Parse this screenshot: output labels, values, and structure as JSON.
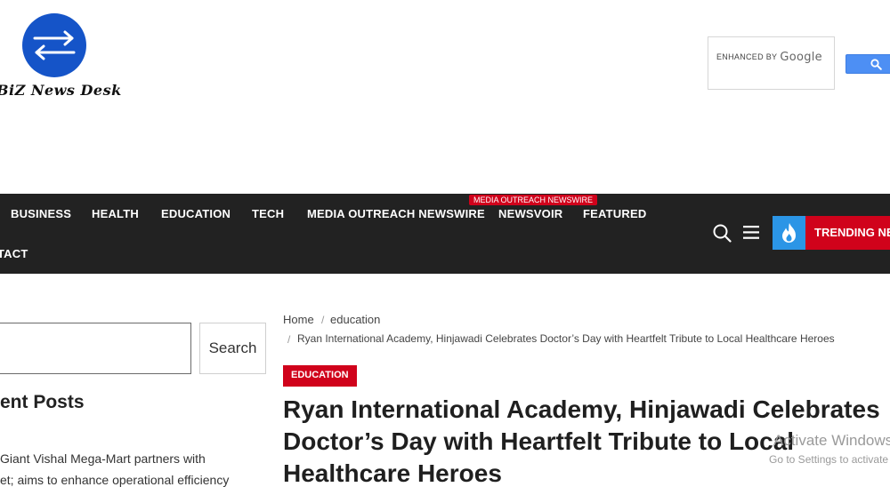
{
  "site": {
    "logo_text": "BiZ News Desk"
  },
  "search_widget": {
    "enhanced_by": "ENHANCED BY",
    "brand": "Google"
  },
  "nav": {
    "items": [
      "BUSINESS",
      "HEALTH",
      "EDUCATION",
      "TECH",
      "MEDIA OUTREACH NEWSWIRE",
      "NEWSVOIR",
      "FEATURED"
    ],
    "row2_item": "TACT",
    "badge": "MEDIA OUTREACH NEWSWIRE",
    "trending_label": "TRENDING NEWS"
  },
  "sidebar": {
    "search_button": "Search",
    "recent_heading": "ent Posts",
    "recent_lines": [
      "Giant Vishal Mega-Mart partners with",
      "et; aims to enhance operational efficiency"
    ]
  },
  "breadcrumb": {
    "home": "Home",
    "sep": "/",
    "category": "education",
    "current": "Ryan International Academy, Hinjawadi Celebrates Doctor’s Day with Heartfelt Tribute to Local Healthcare Heroes"
  },
  "article": {
    "category": "EDUCATION",
    "title_lines": [
      "Ryan International Academy, Hinjawadi Celebrates",
      "Doctor’s Day with Heartfelt Tribute to Local",
      "Healthcare Heroes"
    ]
  },
  "watermark": {
    "line1": "Activate Windows",
    "line2": "Go to Settings to activate Windows."
  },
  "colors": {
    "nav_bg": "#222222",
    "accent_red": "#d0021b",
    "trend_blue": "#2b95e6",
    "logo_blue": "#1554c8",
    "google_blue": "#4d8ff4"
  },
  "icons": [
    "swap-arrows-icon",
    "magnifier-icon",
    "search-icon",
    "hamburger-icon",
    "flame-icon"
  ]
}
